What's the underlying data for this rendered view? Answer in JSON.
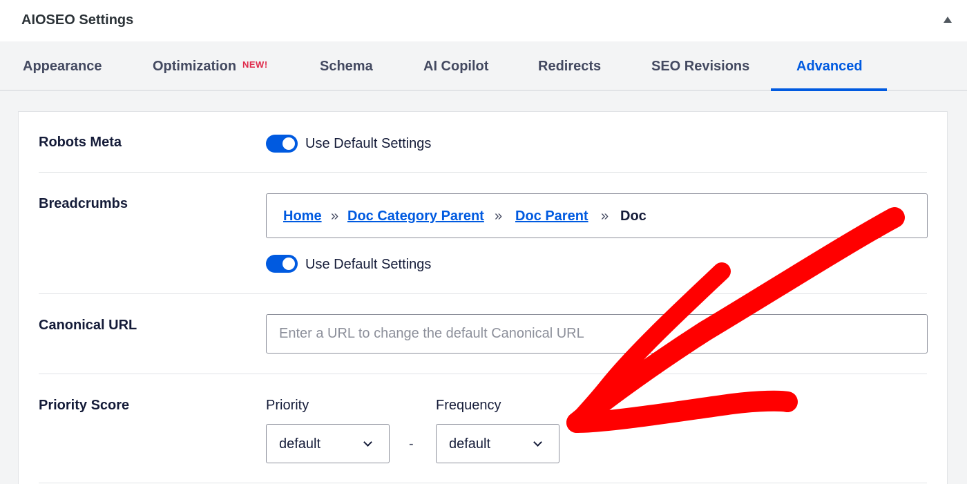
{
  "panel": {
    "title": "AIOSEO Settings"
  },
  "tabs": [
    {
      "label": "Appearance"
    },
    {
      "label": "Optimization",
      "badge": "NEW!"
    },
    {
      "label": "Schema"
    },
    {
      "label": "AI Copilot"
    },
    {
      "label": "Redirects"
    },
    {
      "label": "SEO Revisions"
    },
    {
      "label": "Advanced",
      "active": true
    }
  ],
  "robots_meta": {
    "label": "Robots Meta",
    "toggle_label": "Use Default Settings",
    "toggle_on": true
  },
  "breadcrumbs": {
    "label": "Breadcrumbs",
    "items": [
      "Home",
      "Doc Category Parent",
      "Doc Parent",
      "Doc"
    ],
    "separator": "»",
    "toggle_label": "Use Default Settings",
    "toggle_on": true
  },
  "canonical_url": {
    "label": "Canonical URL",
    "placeholder": "Enter a URL to change the default Canonical URL",
    "value": ""
  },
  "priority_score": {
    "label": "Priority Score",
    "priority_label": "Priority",
    "priority_value": "default",
    "separator": "-",
    "frequency_label": "Frequency",
    "frequency_value": "default"
  },
  "colors": {
    "accent": "#005ae0",
    "annotation_arrow": "#ff0000",
    "badge": "#df2a4a"
  }
}
